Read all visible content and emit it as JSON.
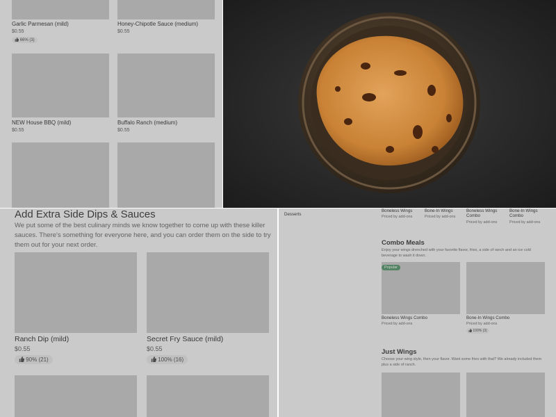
{
  "top_grid": {
    "items": [
      {
        "name": "Garlic Parmesan (mild)",
        "price": "$0.55",
        "rating": "66% (3)"
      },
      {
        "name": "Honey-Chipotle Sauce (medium)",
        "price": "$0.55"
      },
      {
        "name": "NEW House BBQ (mild)",
        "price": "$0.55"
      },
      {
        "name": "Buffalo Ranch (medium)",
        "price": "$0.55"
      }
    ]
  },
  "photo": {
    "subject": "chocolate chip cookie in skillet"
  },
  "sauces_section": {
    "title": "Add Extra Side Dips & Sauces",
    "description": "We put some of the best culinary minds we know together to come up with these killer sauces. There's something for everyone here, and you can order them on the side to try them out for your next order.",
    "items": [
      {
        "name": "Ranch Dip (mild)",
        "price": "$0.55",
        "rating": "90% (21)"
      },
      {
        "name": "Secret Fry Sauce (mild)",
        "price": "$0.55",
        "rating": "100% (16)"
      }
    ]
  },
  "menu": {
    "sidebar_item": "Desserts",
    "top_row": [
      {
        "name": "Boneless Wings",
        "sub": "Priced by add-ons"
      },
      {
        "name": "Bone-In Wings",
        "sub": "Priced by add-ons"
      },
      {
        "name": "Boneless Wings Combo",
        "sub": "Priced by add-ons"
      },
      {
        "name": "Bone-In Wings Combo",
        "sub": "Priced by add-ons"
      }
    ],
    "combo": {
      "title": "Combo Meals",
      "description": "Enjoy your wings drenched with your favorite flavor, fries, a side of ranch and an ice cold beverage to wash it down.",
      "badge": "Popular",
      "items": [
        {
          "name": "Boneless Wings Combo",
          "sub": "Priced by add-ons"
        },
        {
          "name": "Bone-In Wings Combo",
          "sub": "Priced by add-ons",
          "rating": "100% (3)"
        }
      ]
    },
    "just_wings": {
      "title": "Just Wings",
      "description": "Choose your wing style, then your flavor. Want some fries with that? We already included them plus a side of ranch."
    }
  },
  "colors": {
    "placeholder": "#c4c4c4",
    "badge": "#3e8a58",
    "overlay": "#8a8a8a"
  }
}
